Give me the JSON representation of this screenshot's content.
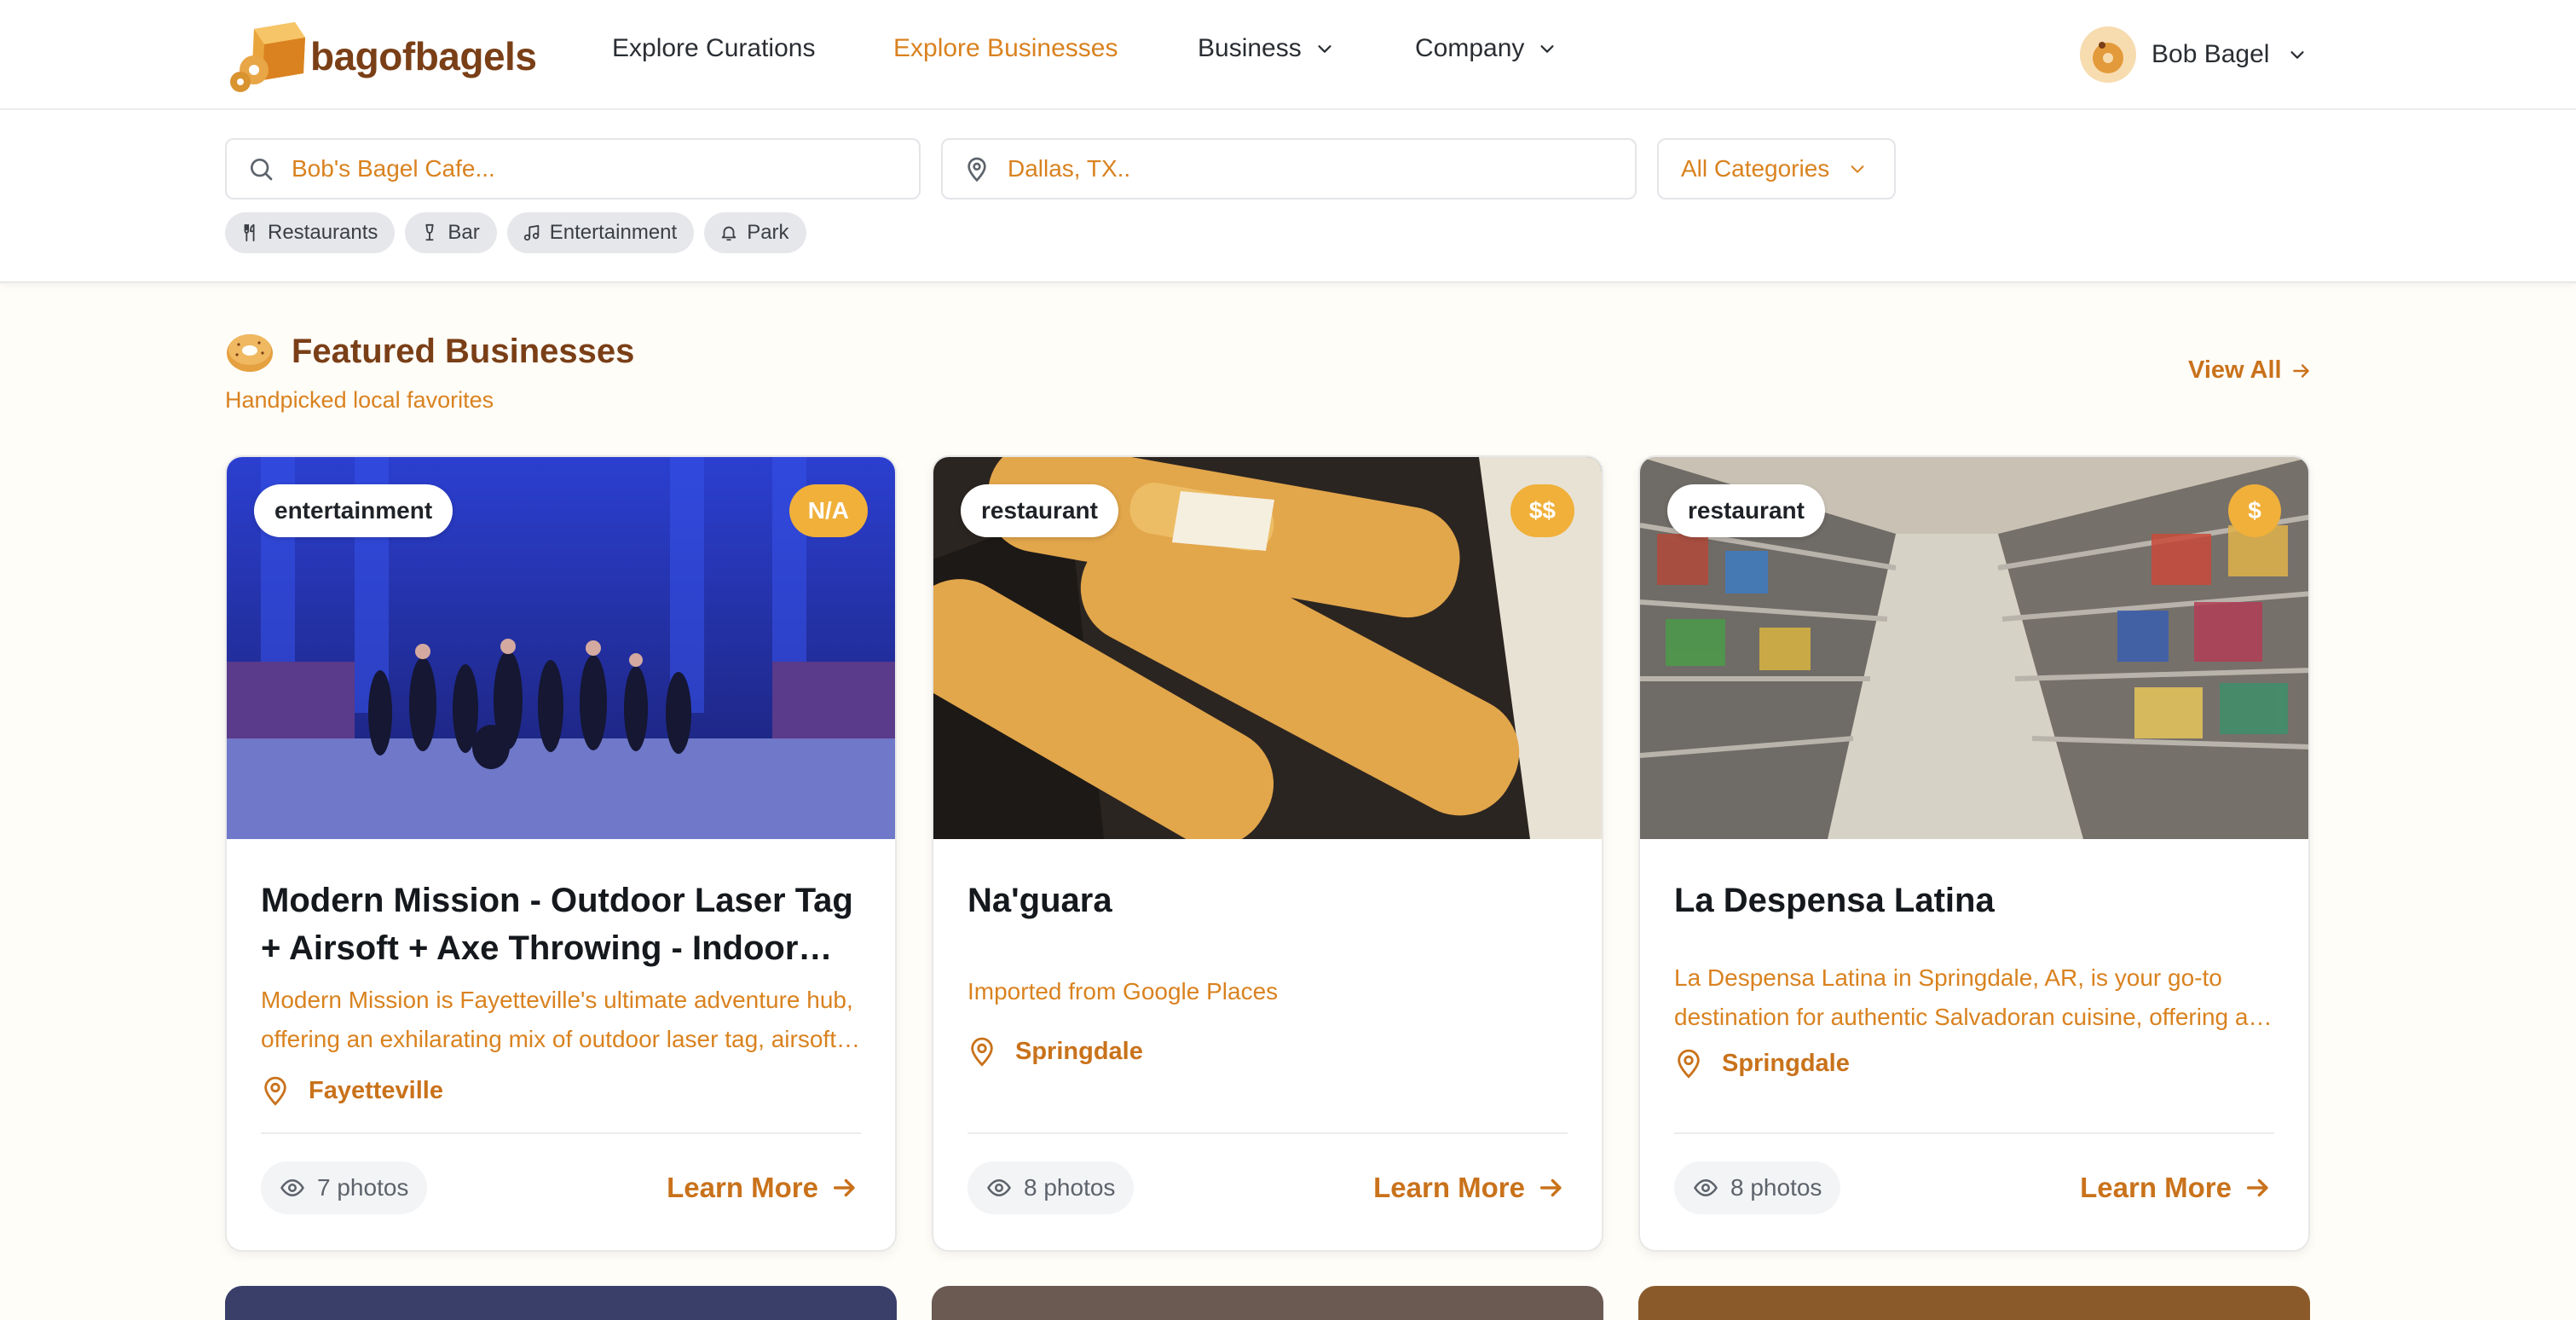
{
  "nav": {
    "logo_text": "bagofbagels",
    "links": [
      {
        "label": "Explore Curations"
      },
      {
        "label": "Explore Businesses"
      },
      {
        "label": "Business"
      },
      {
        "label": "Company"
      }
    ],
    "user_name": "Bob Bagel",
    "accent": "#d9821f"
  },
  "search": {
    "query_placeholder": "Bob's Bagel Cafe...",
    "location_placeholder": "Dallas, TX..",
    "category_value": "All Categories",
    "chips": [
      {
        "label": "Restaurants",
        "icon": "utensils-icon"
      },
      {
        "label": "Bar",
        "icon": "wine-glass-icon"
      },
      {
        "label": "Entertainment",
        "icon": "music-icon"
      },
      {
        "label": "Park",
        "icon": "bell-icon"
      }
    ]
  },
  "featured": {
    "title": "Featured Businesses",
    "subtitle": "Handpicked local favorites",
    "view_all": "View All",
    "cards": [
      {
        "category": "entertainment",
        "price": "N/A",
        "title": "Modern Mission - Outdoor Laser Tag + Airsoft + Axe Throwing - Indoor Laser Tag",
        "description": "Modern Mission is Fayetteville's ultimate adventure hub, offering an exhilarating mix of outdoor laser tag, airsoft, and axe throwing.",
        "location": "Fayetteville",
        "photos": "7 photos",
        "cta": "Learn More"
      },
      {
        "category": "restaurant",
        "price": "$$",
        "title": "Na'guara",
        "description": "Imported from Google Places",
        "location": "Springdale",
        "photos": "8 photos",
        "cta": "Learn More"
      },
      {
        "category": "restaurant",
        "price": "$",
        "title": "La Despensa Latina",
        "description": "La Despensa Latina in Springdale, AR, is your go-to destination for authentic Salvadoran cuisine, offering a variety of dishes.",
        "location": "Springdale",
        "photos": "8 photos",
        "cta": "Learn More"
      }
    ]
  }
}
